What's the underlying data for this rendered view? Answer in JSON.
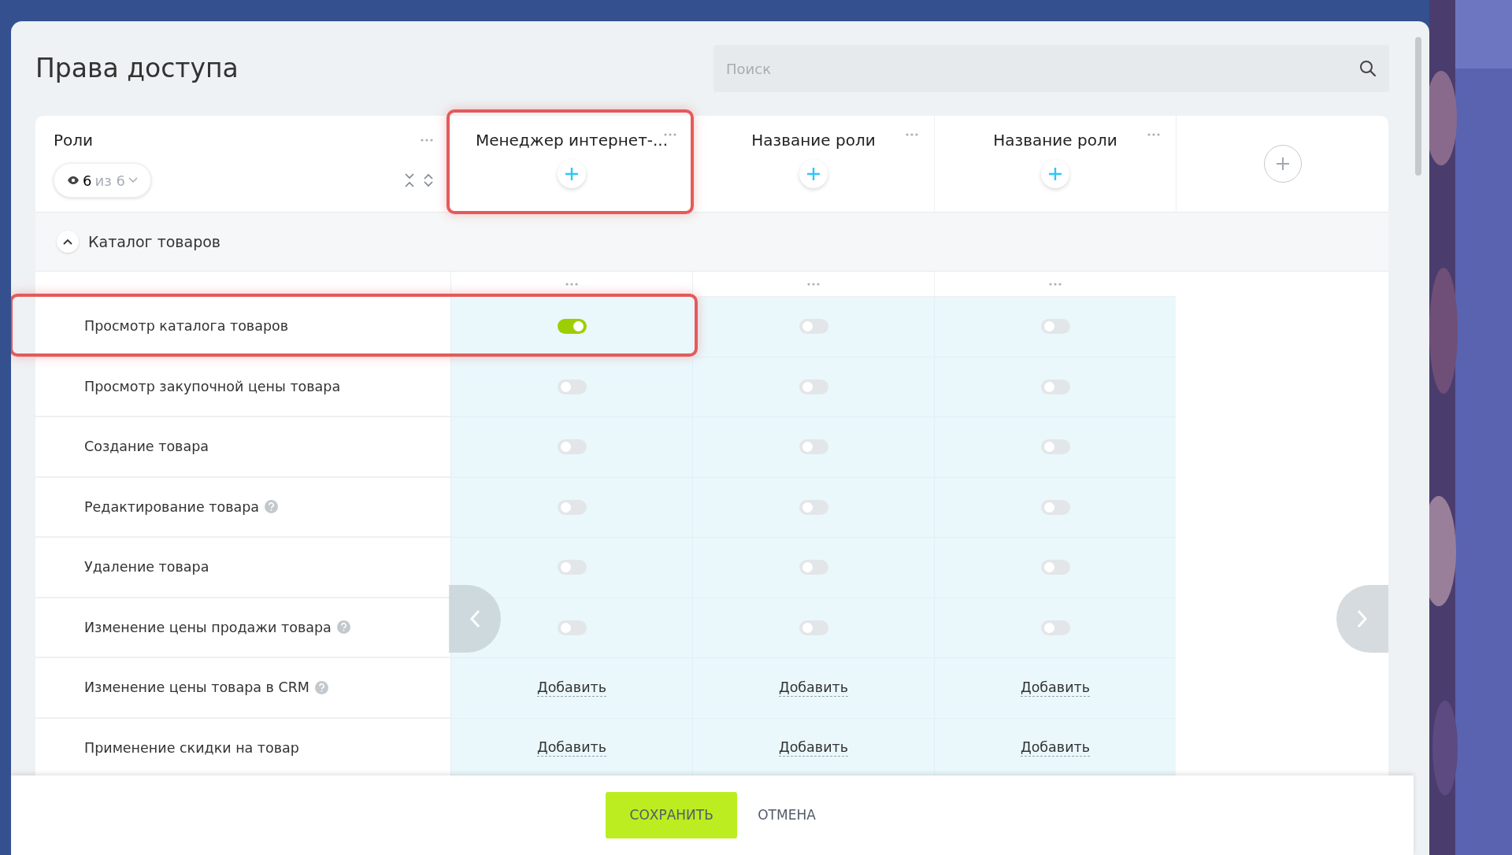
{
  "title": "Права доступа",
  "search": {
    "placeholder": "Поиск"
  },
  "roles_column": {
    "title": "Роли",
    "visible_count": "6",
    "of_text": "из 6"
  },
  "roles": [
    {
      "title": "Менеджер интернет-...",
      "highlighted": true
    },
    {
      "title": "Название роли",
      "highlighted": false
    },
    {
      "title": "Название роли",
      "highlighted": false
    }
  ],
  "section": {
    "title": "Каталог товаров",
    "expanded": true
  },
  "rows": [
    {
      "label": "Просмотр каталога товаров",
      "help": false,
      "highlighted": true,
      "cells": [
        {
          "kind": "toggle",
          "on": true
        },
        {
          "kind": "toggle",
          "on": false
        },
        {
          "kind": "toggle",
          "on": false
        }
      ]
    },
    {
      "label": "Просмотр закупочной цены товара",
      "help": false,
      "highlighted": false,
      "cells": [
        {
          "kind": "toggle",
          "on": false
        },
        {
          "kind": "toggle",
          "on": false
        },
        {
          "kind": "toggle",
          "on": false
        }
      ]
    },
    {
      "label": "Создание товара",
      "help": false,
      "highlighted": false,
      "cells": [
        {
          "kind": "toggle",
          "on": false
        },
        {
          "kind": "toggle",
          "on": false
        },
        {
          "kind": "toggle",
          "on": false
        }
      ]
    },
    {
      "label": "Редактирование товара",
      "help": true,
      "highlighted": false,
      "cells": [
        {
          "kind": "toggle",
          "on": false
        },
        {
          "kind": "toggle",
          "on": false
        },
        {
          "kind": "toggle",
          "on": false
        }
      ]
    },
    {
      "label": "Удаление товара",
      "help": false,
      "highlighted": false,
      "cells": [
        {
          "kind": "toggle",
          "on": false
        },
        {
          "kind": "toggle",
          "on": false
        },
        {
          "kind": "toggle",
          "on": false
        }
      ]
    },
    {
      "label": "Изменение цены продажи товара",
      "help": true,
      "highlighted": false,
      "cells": [
        {
          "kind": "toggle",
          "on": false
        },
        {
          "kind": "toggle",
          "on": false
        },
        {
          "kind": "toggle",
          "on": false
        }
      ]
    },
    {
      "label": "Изменение цены товара в CRM",
      "help": true,
      "highlighted": false,
      "cells": [
        {
          "kind": "add",
          "text": "Добавить"
        },
        {
          "kind": "add",
          "text": "Добавить"
        },
        {
          "kind": "add",
          "text": "Добавить"
        }
      ]
    },
    {
      "label": "Применение скидки на товар",
      "help": false,
      "highlighted": false,
      "cells": [
        {
          "kind": "add",
          "text": "Добавить"
        },
        {
          "kind": "add",
          "text": "Добавить"
        },
        {
          "kind": "add",
          "text": "Добавить"
        }
      ]
    }
  ],
  "buttons": {
    "save": "СОХРАНИТЬ",
    "cancel": "ОТМЕНА"
  }
}
